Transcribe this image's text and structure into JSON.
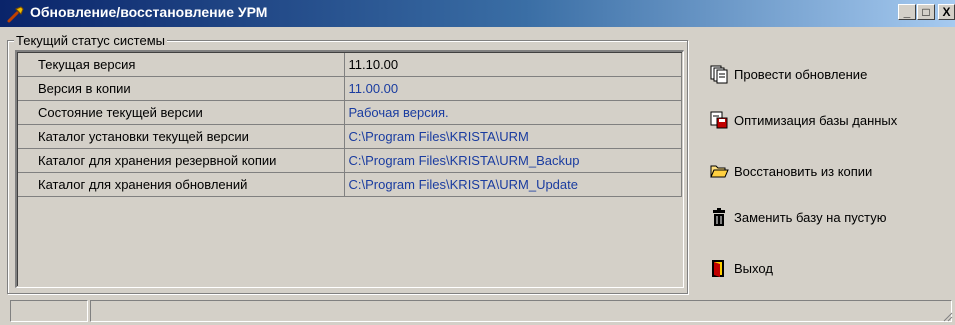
{
  "window": {
    "title": "Обновление/восстановление УРМ",
    "minimize_label": "_",
    "maximize_label": "□",
    "close_label": "X"
  },
  "status_group": {
    "legend": "Текущий статус системы",
    "rows": [
      {
        "key": "Текущая версия",
        "value": "11.10.00"
      },
      {
        "key": "Версия в копии",
        "value": "11.00.00"
      },
      {
        "key": "Состояние текущей версии",
        "value": "Рабочая версия."
      },
      {
        "key": "Каталог установки текущей версии",
        "value": "C:\\Program Files\\KRISTA\\URM"
      },
      {
        "key": "Каталог для хранения резервной копии",
        "value": "C:\\Program Files\\KRISTA\\URM_Backup"
      },
      {
        "key": "Каталог для хранения обновлений",
        "value": "C:\\Program Files\\KRISTA\\URM_Update"
      }
    ]
  },
  "actions": {
    "update": {
      "label": "Провести обновление",
      "icon": "copy-pages-icon"
    },
    "optimize": {
      "label": "Оптимизация базы данных",
      "icon": "database-optimize-icon"
    },
    "restore": {
      "label": "Восстановить из копии",
      "icon": "open-folder-icon"
    },
    "replace": {
      "label": "Заменить базу на пустую",
      "icon": "trash-can-icon"
    },
    "exit": {
      "label": "Выход",
      "icon": "exit-door-icon"
    }
  },
  "colors": {
    "title_gradient_start": "#0a246a",
    "title_gradient_end": "#a6caf0",
    "value_text": "#1a3ca0",
    "window_bg": "#d4d0c8"
  }
}
